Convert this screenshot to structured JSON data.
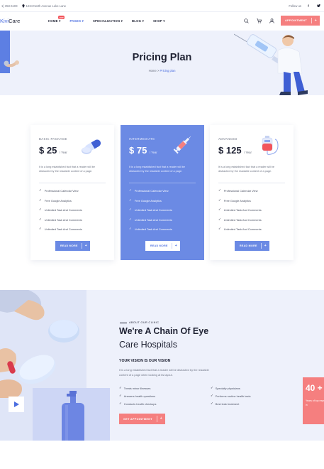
{
  "topbar": {
    "phone": "1) 353-6103",
    "address": "1234 North Avenue Luke Lane",
    "follow_label": "Follow us",
    "social_icons": [
      "facebook-icon",
      "twitter-icon"
    ]
  },
  "nav": {
    "logo_accent": "Kivi",
    "logo_rest": "Care",
    "items": [
      {
        "label": "HOME ▾",
        "badge": "HOT",
        "active": false
      },
      {
        "label": "PAGES ▾",
        "active": true
      },
      {
        "label": "SPECIALIZATION ▾",
        "active": false
      },
      {
        "label": "BLOG ▾",
        "active": false
      },
      {
        "label": "SHOP ▾",
        "active": false
      }
    ],
    "appointment_label": "APPOINTMENT"
  },
  "hero": {
    "title": "Pricing Plan",
    "breadcrumb_home": "Home",
    "breadcrumb_sep": " > ",
    "breadcrumb_current": "Pricing plan"
  },
  "plans": [
    {
      "name": "BASIC PACKAGE",
      "currency": "$",
      "amount": "25",
      "period": "/ Year",
      "illustration": "pills-icon",
      "description": "It is a long established fact that a reader will be distracted by the readable content of a page.",
      "features": [
        "Professional Calendar View",
        "Free Google Analytics",
        "Unlimited Task And Comments",
        "Unlimited Task And Comments",
        "Unlimited Task And Comments"
      ],
      "button": "READ MORE"
    },
    {
      "name": "INTERMEDIATE",
      "currency": "$",
      "amount": "75",
      "period": "/ Year",
      "illustration": "syringe-icon",
      "description": "It is a long established fact that a reader will be distracted by the readable content of a page.",
      "features": [
        "Professional Calendar View",
        "Free Google Analytics",
        "Unlimited Task And Comments",
        "Unlimited Task And Comments",
        "Unlimited Task And Comments"
      ],
      "button": "READ MORE"
    },
    {
      "name": "ADVANCED",
      "currency": "$",
      "amount": "125",
      "period": "/ Year",
      "illustration": "blood-bag-icon",
      "description": "It is a long established fact that a reader will be distracted by the readable content of a page.",
      "features": [
        "Professional Calendar View",
        "Free Google Analytics",
        "Unlimited Task And Comments",
        "Unlimited Task And Comments",
        "Unlimited Task And Comments"
      ],
      "button": "READ MORE"
    }
  ],
  "about": {
    "kicker": "ABOUT OUR CLINIC",
    "title_line1": "We're A Chain Of Eye",
    "title_line2": "Care Hospitals",
    "vision": "YOUR VISION IS OUR VISION",
    "description": "It is a long established fact that a reader will be distracted by the readable content of a page when looking at its layout.",
    "features_left": [
      "Treats minor illnesses",
      "Answers health questions",
      "Conducts health checkups"
    ],
    "features_right": [
      "Specialty physicians",
      "Performs routine health tests",
      "Best leak treatment"
    ],
    "button": "GET APPOINTMENT",
    "experience_number": "40 +",
    "experience_text": "Years of top experience in"
  },
  "colors": {
    "accent": "#4b6ee0",
    "card_featured": "#6b8ae4",
    "coral": "#f57f7f",
    "hero_bg": "#eef1fb"
  }
}
